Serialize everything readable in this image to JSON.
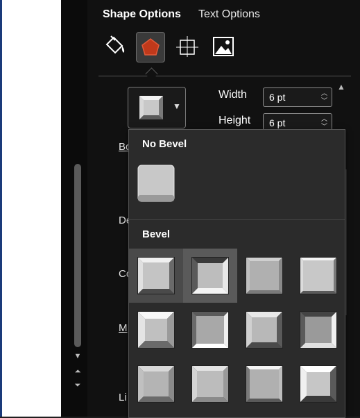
{
  "tabs": {
    "shape_options": "Shape Options",
    "text_options": "Text Options"
  },
  "categories": [
    {
      "name": "fill-line",
      "icon": "paint-bucket-icon"
    },
    {
      "name": "effects",
      "icon": "pentagon-icon",
      "selected": true
    },
    {
      "name": "size-properties",
      "icon": "size-properties-icon"
    },
    {
      "name": "picture",
      "icon": "picture-icon"
    }
  ],
  "bevel": {
    "width_label": "Width",
    "width_value": "6 pt",
    "height_label": "Height",
    "height_value": "6 pt"
  },
  "side_labels": {
    "bo": "Bo",
    "de": "De",
    "co": "Co",
    "ma": "M",
    "li": "Li"
  },
  "gallery": {
    "no_bevel_header": "No Bevel",
    "bevel_header": "Bevel"
  },
  "colors": {
    "panel_bg": "#111111",
    "gallery_bg": "#2b2b2b",
    "accent_red": "#c0391b"
  }
}
